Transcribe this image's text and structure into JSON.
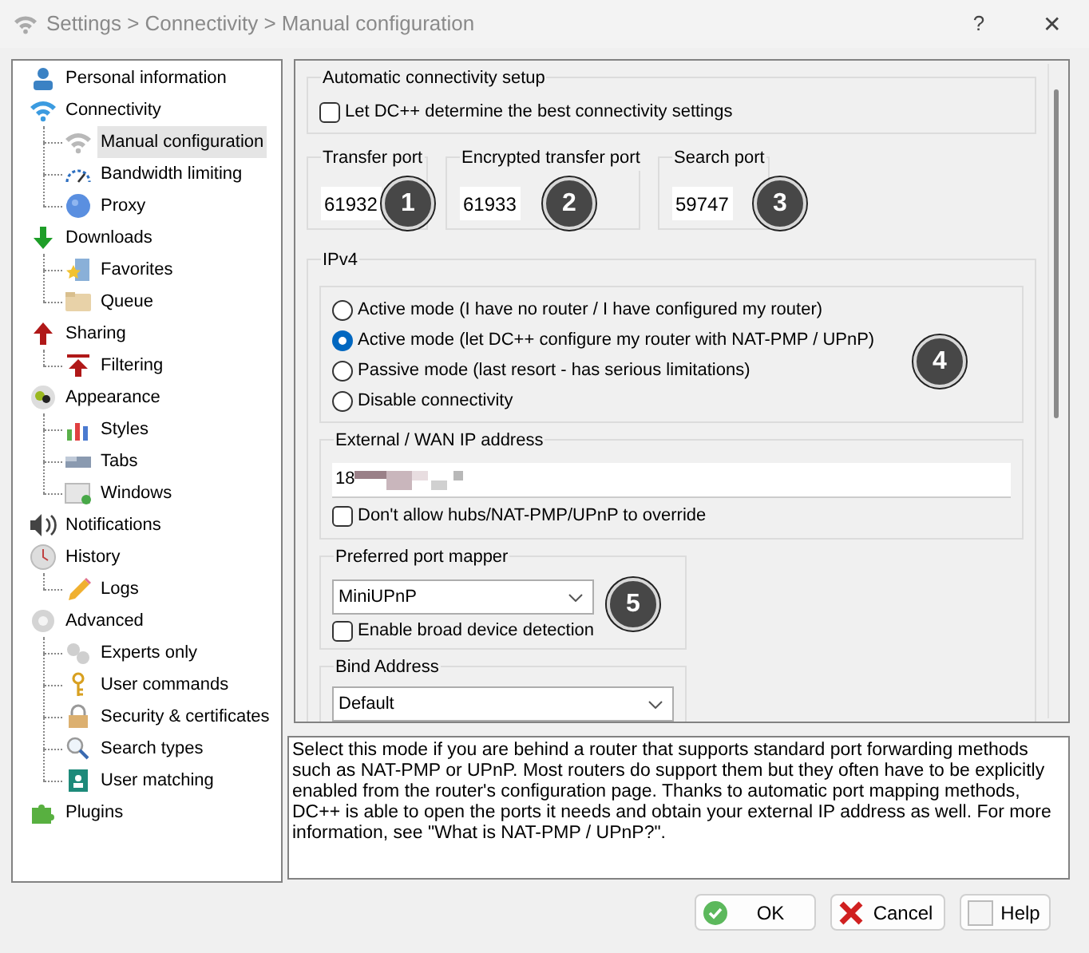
{
  "window": {
    "title": "Settings > Connectivity > Manual configuration",
    "help_glyph": "?",
    "close_glyph": "✕"
  },
  "tree": [
    {
      "label": "Personal information",
      "selected": false
    },
    {
      "label": "Connectivity",
      "selected": false,
      "children": [
        {
          "label": "Manual configuration",
          "selected": true
        },
        {
          "label": "Bandwidth limiting",
          "selected": false
        },
        {
          "label": "Proxy",
          "selected": false
        }
      ]
    },
    {
      "label": "Downloads",
      "selected": false,
      "children": [
        {
          "label": "Favorites",
          "selected": false
        },
        {
          "label": "Queue",
          "selected": false
        }
      ]
    },
    {
      "label": "Sharing",
      "selected": false,
      "children": [
        {
          "label": "Filtering",
          "selected": false
        }
      ]
    },
    {
      "label": "Appearance",
      "selected": false,
      "children": [
        {
          "label": "Styles",
          "selected": false
        },
        {
          "label": "Tabs",
          "selected": false
        },
        {
          "label": "Windows",
          "selected": false
        }
      ]
    },
    {
      "label": "Notifications",
      "selected": false
    },
    {
      "label": "History",
      "selected": false,
      "children": [
        {
          "label": "Logs",
          "selected": false
        }
      ]
    },
    {
      "label": "Advanced",
      "selected": false,
      "children": [
        {
          "label": "Experts only",
          "selected": false
        },
        {
          "label": "User commands",
          "selected": false
        },
        {
          "label": "Security & certificates",
          "selected": false
        },
        {
          "label": "Search types",
          "selected": false
        },
        {
          "label": "User matching",
          "selected": false
        }
      ]
    },
    {
      "label": "Plugins",
      "selected": false
    }
  ],
  "auto_setup": {
    "title": "Automatic connectivity setup",
    "checkbox": {
      "label": "Let DC++ determine the best connectivity settings",
      "checked": false
    }
  },
  "ports": [
    {
      "title": "Transfer port",
      "value": "61932"
    },
    {
      "title": "Encrypted transfer port",
      "value": "61933"
    },
    {
      "title": "Search port",
      "value": "59747"
    }
  ],
  "ipv4": {
    "title": "IPv4",
    "modes": [
      {
        "label": "Active mode (I have no router / I have configured my router)",
        "selected": false
      },
      {
        "label": "Active mode (let DC++ configure my router with NAT-PMP / UPnP)",
        "selected": true
      },
      {
        "label": "Passive mode (last resort - has serious limitations)",
        "selected": false
      },
      {
        "label": "Disable connectivity",
        "selected": false
      }
    ],
    "external_ip": {
      "title": "External / WAN IP address",
      "value": "18",
      "checkbox": {
        "label": "Don't allow hubs/NAT-PMP/UPnP to override",
        "checked": false
      }
    },
    "port_mapper": {
      "title": "Preferred port mapper",
      "value": "MiniUPnP",
      "checkbox": {
        "label": "Enable broad device detection",
        "checked": false
      }
    },
    "bind_address": {
      "title": "Bind Address",
      "value": "Default"
    }
  },
  "callouts": [
    "1",
    "2",
    "3",
    "4",
    "5"
  ],
  "description": "Select this mode if you are behind a router that supports standard port forwarding methods such as NAT-PMP or UPnP. Most routers do support them but they often have to be explicitly enabled from the router's configuration page. Thanks to automatic port mapping methods, DC++ is able to open the ports it needs and obtain your external IP address as well. For more information, see \"What is NAT-PMP / UPnP?\".",
  "buttons": [
    {
      "label": "OK",
      "kind": "ok"
    },
    {
      "label": "Cancel",
      "kind": "cancel"
    },
    {
      "label": "Help",
      "kind": "help"
    }
  ]
}
